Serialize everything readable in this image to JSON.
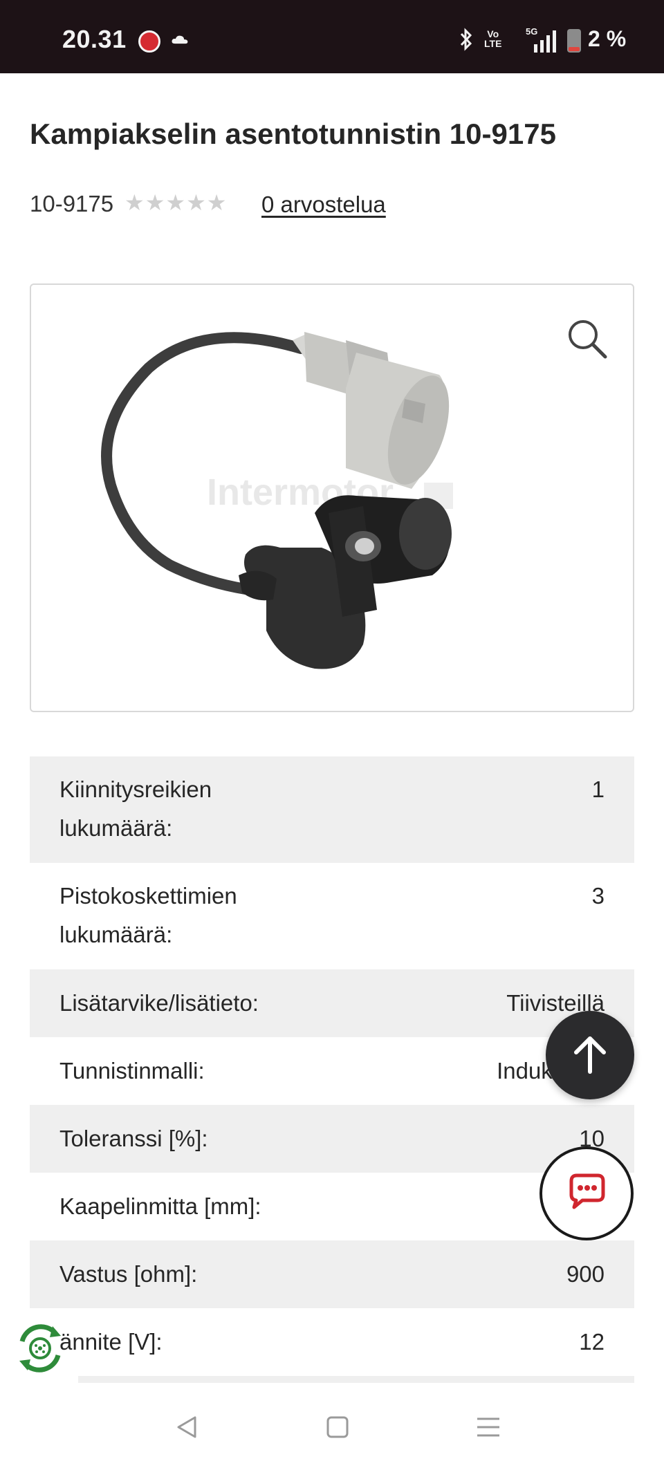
{
  "status_bar": {
    "time": "20.31",
    "network": "5G",
    "volte": "Vo LTE",
    "battery": "2 %"
  },
  "product": {
    "title": "Kampiakselin asentotunnistin 10-9175",
    "sku": "10-9175",
    "rating_stars": "★★★★★",
    "reviews_link": "0 arvostelua",
    "image_watermark": "Intermotor"
  },
  "specs": [
    {
      "label": "Kiinnitysreikien lukumäärä:",
      "value": "1"
    },
    {
      "label": "Pistokoskettimien lukumäärä:",
      "value": "3"
    },
    {
      "label": "Lisätarvike/lisätieto:",
      "value": "Tiivisteillä"
    },
    {
      "label": "Tunnistinmalli:",
      "value": "Induktiivi a"
    },
    {
      "label": "Toleranssi [%]:",
      "value": "10"
    },
    {
      "label": "Kaapelinmitta [mm]:",
      "value": ""
    },
    {
      "label": "Vastus [ohm]:",
      "value": "900"
    },
    {
      "label": "ännite [V]:",
      "value": "12"
    }
  ],
  "icons": {
    "zoom": "magnifier-icon",
    "scroll_top": "arrow-up-icon",
    "chat": "chat-bubble-icon",
    "eco": "recycle-badge-icon",
    "nav_back": "triangle-back-icon",
    "nav_home": "square-home-icon",
    "nav_menu": "hamburger-icon"
  },
  "colors": {
    "status_bar_bg": "#1d1216",
    "row_alt_bg": "#efefef",
    "fab_dark": "#2b2b2d",
    "chat_red": "#d0262e",
    "eco_green": "#2e8b3a"
  }
}
